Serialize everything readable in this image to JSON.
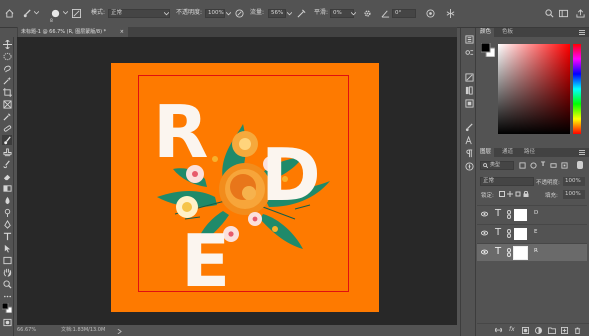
{
  "options": {
    "mode_label": "模式:",
    "mode_value": "正常",
    "opacity_label": "不透明度:",
    "opacity_value": "100%",
    "flow_label": "流量:",
    "flow_value": "56%",
    "smooth_label": "平滑:",
    "smooth_value": "0%",
    "brush_size": "8",
    "angle_value": "0°"
  },
  "document": {
    "tab_title": "未标题-1 @ 66.7% (R, 图层蒙版/8) *",
    "tab_close": "×",
    "letters": [
      "R",
      "D",
      "E"
    ],
    "colors": {
      "background": "#fe7a00",
      "frame": "#e01010",
      "letters": "#fbf5ef"
    }
  },
  "status": {
    "zoom": "66.67%",
    "doc_info": "文档:1.83M/13.0M"
  },
  "color_panel": {
    "tabs": [
      "颜色",
      "色板"
    ]
  },
  "layers_panel": {
    "tabs": [
      "图层",
      "通道",
      "路径"
    ],
    "kind_label": "类型",
    "blend_mode": "正常",
    "opacity_label": "不透明度:",
    "opacity_value": "100%",
    "lock_label": "锁定:",
    "fill_label": "填充:",
    "fill_value": "100%",
    "layers": [
      {
        "name": "D",
        "type": "T"
      },
      {
        "name": "E",
        "type": "T"
      },
      {
        "name": "R",
        "type": "T"
      }
    ]
  }
}
